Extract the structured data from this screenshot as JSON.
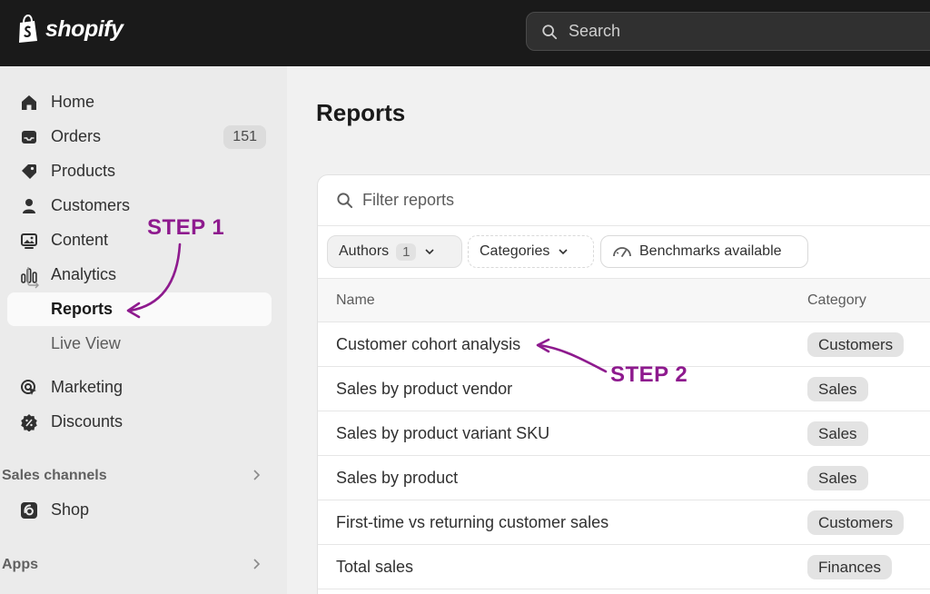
{
  "brand": {
    "name": "shopify"
  },
  "search": {
    "placeholder": "Search"
  },
  "sidebar": {
    "items": [
      {
        "label": "Home",
        "icon": "home-icon"
      },
      {
        "label": "Orders",
        "icon": "orders-icon",
        "badge": "151"
      },
      {
        "label": "Products",
        "icon": "tag-icon"
      },
      {
        "label": "Customers",
        "icon": "person-icon"
      },
      {
        "label": "Content",
        "icon": "content-icon"
      },
      {
        "label": "Analytics",
        "icon": "analytics-icon"
      },
      {
        "label": "Reports",
        "active": true
      },
      {
        "label": "Live View"
      },
      {
        "label": "Marketing",
        "icon": "target-icon"
      },
      {
        "label": "Discounts",
        "icon": "discount-icon"
      }
    ],
    "sales_channels": {
      "label": "Sales channels",
      "items": [
        {
          "label": "Shop",
          "icon": "shop-icon"
        }
      ]
    },
    "apps": {
      "label": "Apps"
    }
  },
  "main": {
    "title": "Reports",
    "filter": {
      "placeholder": "Filter reports"
    },
    "chips": {
      "authors": {
        "label": "Authors",
        "count": "1"
      },
      "categories": {
        "label": "Categories"
      },
      "benchmarks": {
        "label": "Benchmarks available"
      }
    },
    "table": {
      "headers": {
        "name": "Name",
        "category": "Category"
      },
      "rows": [
        {
          "name": "Customer cohort analysis",
          "category": "Customers"
        },
        {
          "name": "Sales by product vendor",
          "category": "Sales"
        },
        {
          "name": "Sales by product variant SKU",
          "category": "Sales"
        },
        {
          "name": "Sales by product",
          "category": "Sales"
        },
        {
          "name": "First-time vs returning customer sales",
          "category": "Customers"
        },
        {
          "name": "Total sales",
          "category": "Finances"
        }
      ]
    }
  },
  "annotations": {
    "step1": "STEP 1",
    "step2": "STEP 2",
    "color": "#8e1a8e"
  }
}
